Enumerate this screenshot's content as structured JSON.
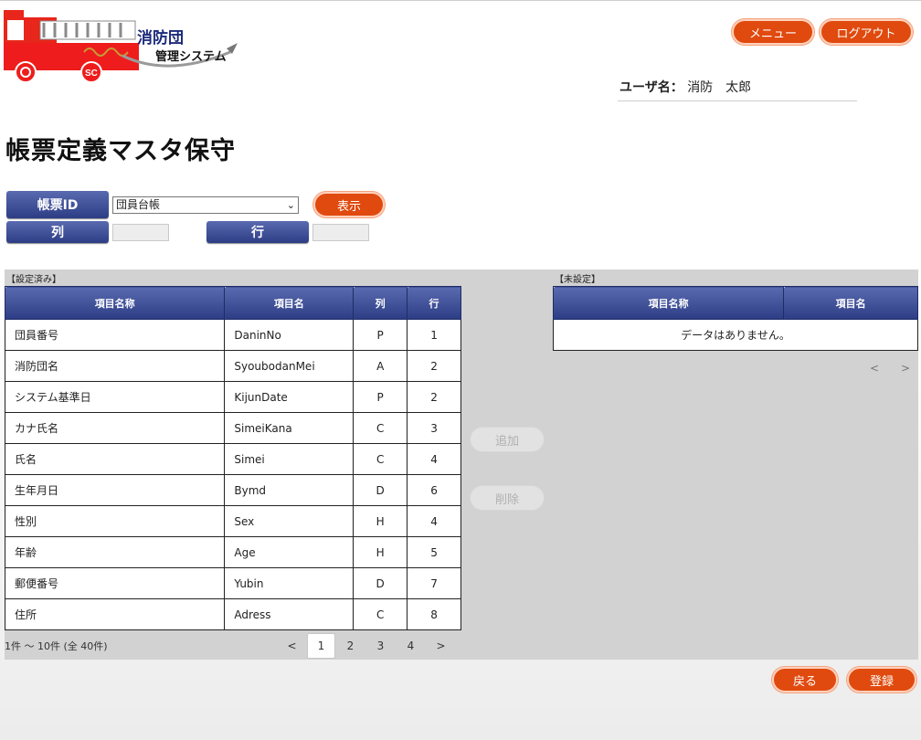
{
  "header": {
    "logo_line1": "消防団",
    "logo_line2": "管理システム",
    "menu_label": "メニュー",
    "logout_label": "ログアウト",
    "user_label": "ユーザ名：",
    "user_name": "消防　太郎"
  },
  "page": {
    "title": "帳票定義マスタ保守"
  },
  "filter": {
    "id_label": "帳票ID",
    "id_value": "団員台帳",
    "show_label": "表示",
    "col_label": "列",
    "row_label": "行"
  },
  "configured": {
    "section_label": "【設定済み】",
    "headers": [
      "項目名称",
      "項目名",
      "列",
      "行"
    ],
    "rows": [
      [
        "団員番号",
        "DaninNo",
        "P",
        "1"
      ],
      [
        "消防団名",
        "SyoubodanMei",
        "A",
        "2"
      ],
      [
        "システム基準日",
        "KijunDate",
        "P",
        "2"
      ],
      [
        "カナ氏名",
        "SimeiKana",
        "C",
        "3"
      ],
      [
        "氏名",
        "Simei",
        "C",
        "4"
      ],
      [
        "生年月日",
        "Bymd",
        "D",
        "6"
      ],
      [
        "性別",
        "Sex",
        "H",
        "4"
      ],
      [
        "年齢",
        "Age",
        "H",
        "5"
      ],
      [
        "郵便番号",
        "Yubin",
        "D",
        "7"
      ],
      [
        "住所",
        "Adress",
        "C",
        "8"
      ]
    ],
    "paging_text": "1件 ～ 10件 (全 40件)",
    "pages": [
      "<",
      "1",
      "2",
      "3",
      "4",
      ">"
    ],
    "current_page": "1"
  },
  "actions": {
    "add_label": "追加",
    "delete_label": "削除"
  },
  "unconfigured": {
    "section_label": "【未設定】",
    "headers": [
      "項目名称",
      "項目名"
    ],
    "empty_message": "データはありません。",
    "pages": [
      "<",
      ">"
    ]
  },
  "footer": {
    "back_label": "戻る",
    "save_label": "登録"
  },
  "colors": {
    "accent": "#e04a0e",
    "header_blue": "#2d3d85",
    "panel_gray": "#d2d2d2"
  }
}
